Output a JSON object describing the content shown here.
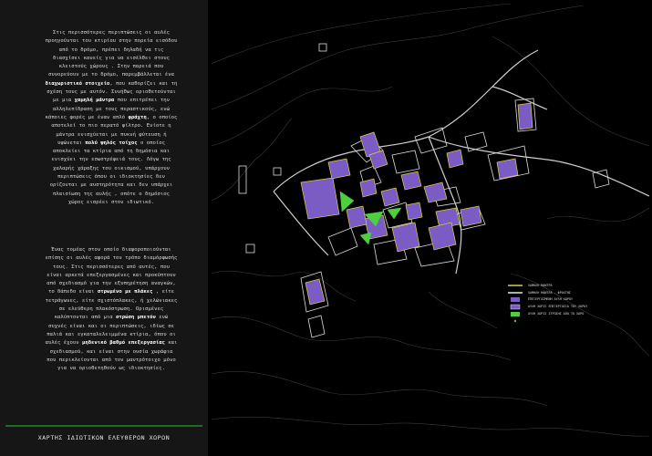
{
  "text_panel": {
    "para1": [
      {
        "t": "Στις περισσότερες περιπτώσεις οι αυλές προηγούνται του κτιρίου στην πορεία εισόδου από το δρόμο, πρέπει δηλαδή να τις διασχίσει κανείς για να εισέλθει στους κλειστούς χώρους . Στην παρειά που συνορεύουν με το δρόμο, παρεμβάλλεται ένα "
      },
      {
        "t": "διαχωριστικό στοιχείο",
        "b": true
      },
      {
        "t": ", που καθορίζει και τη σχέση τους με αυτόν. Συνήθως οριοθετούνται με μια "
      },
      {
        "t": "χαμηλή μάντρα",
        "b": true
      },
      {
        "t": " που επιτρέπει την αλληλεπίδραση με τους περαστικούς, ενώ κάποιες φορές με έναν απλό "
      },
      {
        "t": "φράχτη",
        "b": true
      },
      {
        "t": ", ο οποίος αποτελεί το πιο περατό φίλτρο. Ενίοτε η μάντρα ενισχύεται με πυκνή φύτευση ή υψώνεται "
      },
      {
        "t": "πολύ ψηλός τοίχος",
        "b": true
      },
      {
        "t": " ο οποίος αποκλείει τα κτίρια από τη δημόσια και ενισχύει την εσωστρέφειά τους. Λόγω της χαλαρής χάραξης του οικισμού, υπάρχουν περιπτώσεις όπου οι ιδιοκτησίες δεν ορίζονται με αυστηρότητα και δεν υπάρχει πλαισίωση της αυλής , οπότε ο δημόσιος χώρος εισρέει στον ιδιωτικό."
      }
    ],
    "para2": [
      {
        "t": "Ένας τομέας στον οποίο διαφοροποιούνται επίσης οι αυλές αφορά τον τρόπο διαμόρφωσής τους. Στις περισσότερες από αυτές, που είναι αρκετά επεξεργασμένες και προκύπτουν από σχεδιασμό για την εξυπηρέτηση αναγκών, το δάπεδο είναι "
      },
      {
        "t": "στρωμένο με πλάκες",
        "b": true
      },
      {
        "t": " , είτε τετράγωνες, είτε σχιστόπλακες, ή χελώνιακες σε ελεύθερη πλακόστρωση. Ορισμένες καλύπτονται από μια "
      },
      {
        "t": "στρώση μπετόν",
        "b": true
      },
      {
        "t": " ενώ συχνές είναι και οι περιπτώσεις, ιδίως σε παλιά και εγκαταλελειμμένα κτίρια, όπου οι αυλές έχουν "
      },
      {
        "t": "μηδενικό βαθμό επεξεργασίας",
        "b": true
      },
      {
        "t": " και σχεδιασμού, και είναι στην ουσία χωράφια που περικλείονται από τον μαντρότοιχο μόνο για να οριοθετηθούν ως ιδιοκτησίες."
      }
    ],
    "footer_title": "ΧΑΡΤΗΣ ΙΔΙΩΤΙΚΩΝ ΕΛΕΥΘΕΡΩΝ ΧΩΡΩΝ"
  },
  "legend": [
    {
      "id": "low-wall",
      "label": "ΧΑΜΗΛΗ ΜΑΝΤΡΑ",
      "color": "#d8d04a",
      "kind": "line"
    },
    {
      "id": "tall-wall",
      "label": "ΧΑΜΗΛΗ ΜΑΝΤΡΑ - ΦΡΑΧΤΗΣ",
      "color": "#e8e8e8",
      "kind": "line"
    },
    {
      "id": "paved",
      "label": "ΕΠΕΞΕΡΓΑΣΜΕΝΗ ΑΥΛΗ ΧΩΡΟΥ",
      "color": "#7a5cc4",
      "kind": "fill"
    },
    {
      "id": "unpaved",
      "label": "ΑΥΛΗ ΧΩΡΙΣ ΕΠΕΞΕΡΓΑΣΙΑ ΤΟΥ ΧΩΡΟΥ",
      "color": "#7a5cc4",
      "kind": "fill"
    },
    {
      "id": "green",
      "label": "ΑΥΛΗ ΧΩΡΙΣ ΣΤΡΩΣΗΣ ΑΠΟ ΤΟ ΧΩΡΟ",
      "color": "#4fcf3f",
      "kind": "fill"
    },
    {
      "id": "marker",
      "label": "",
      "color": "#4fcf3f",
      "kind": "dot"
    }
  ],
  "colors": {
    "courtyard": "#7a5cc4",
    "green_courtyard": "#4fcf3f",
    "wall_yellow": "#d8d04a",
    "building_outline": "#dcdcdc",
    "contour": "#3a3a3a",
    "road": "#cfcfcf",
    "panel_bg": "#161616",
    "footer_rule": "#1f6b1f"
  }
}
